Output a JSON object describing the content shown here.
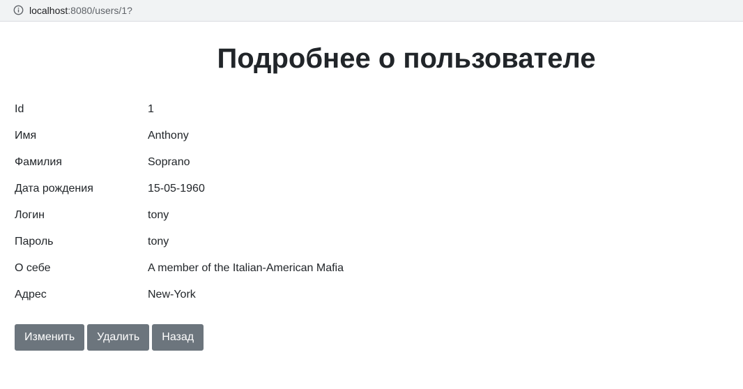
{
  "browser": {
    "url_host": "localhost",
    "url_rest": ":8080/users/1?"
  },
  "page": {
    "title": "Подробнее о пользователе"
  },
  "user_details": [
    {
      "label": "Id",
      "value": "1"
    },
    {
      "label": "Имя",
      "value": "Anthony"
    },
    {
      "label": "Фамилия",
      "value": "Soprano"
    },
    {
      "label": "Дата рождения",
      "value": "15-05-1960"
    },
    {
      "label": "Логин",
      "value": "tony"
    },
    {
      "label": "Пароль",
      "value": "tony"
    },
    {
      "label": "О себе",
      "value": "A member of the Italian-American Mafia"
    },
    {
      "label": "Адрес",
      "value": "New-York"
    }
  ],
  "actions": {
    "edit_label": "Изменить",
    "delete_label": "Удалить",
    "back_label": "Назад"
  },
  "colors": {
    "button_bg": "#6c757d",
    "text": "#212529"
  }
}
